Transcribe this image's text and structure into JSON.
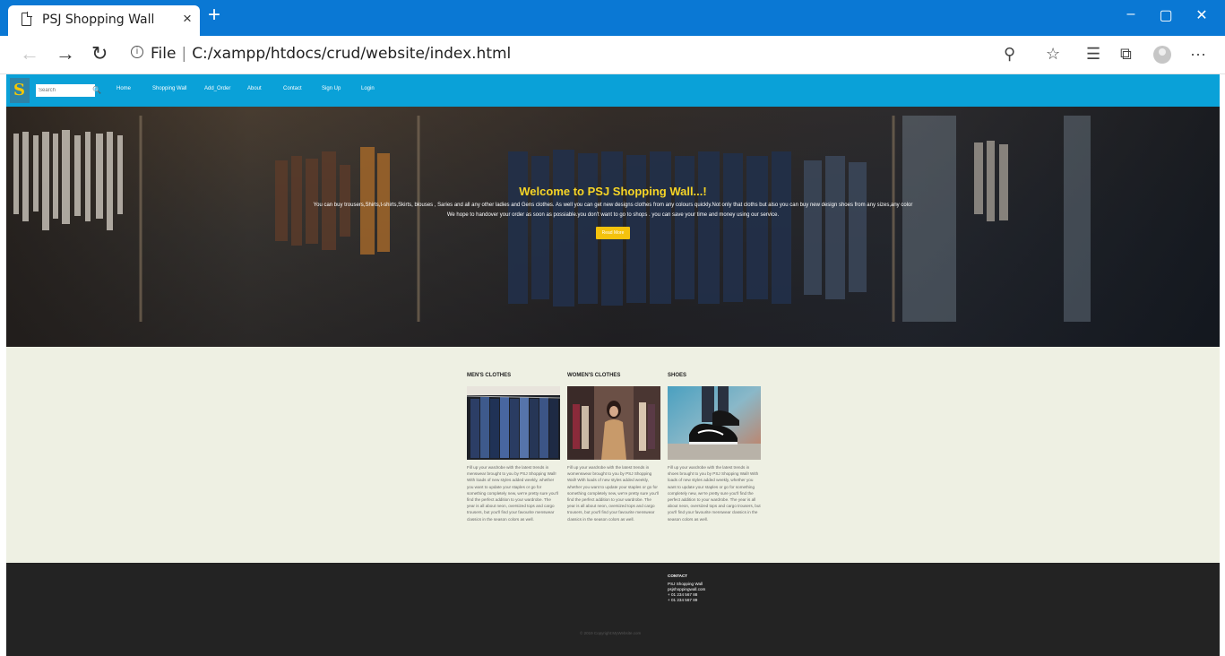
{
  "browser": {
    "tab_title": "PSJ Shopping Wall",
    "tab_close": "×",
    "new_tab": "+",
    "url_scheme": "File",
    "url_path": "C:/xampp/htdocs/crud/website/index.html",
    "window_controls": {
      "minimize": "–",
      "maximize": "▢",
      "close": "✕"
    },
    "icons": [
      "back-icon",
      "forward-icon",
      "refresh-icon",
      "info-icon",
      "zoom-icon",
      "favorite-star-icon",
      "favorites-list-icon",
      "collections-icon",
      "profile-icon",
      "more-icon"
    ],
    "colors": {
      "tabstrip": "#0a78d4"
    }
  },
  "site": {
    "nav": {
      "logo_letter": "S",
      "search_placeholder": "Search",
      "search_icon": "🔍",
      "items": [
        "Home",
        "Shopping Wall",
        "Add_Order",
        "About",
        "Contact",
        "Sign Up",
        "Login"
      ],
      "color": "#0aa1d8"
    },
    "hero": {
      "title": "Welcome to PSJ Shopping Wall...!",
      "line1": "You can buy trousers,Shirts,t-shirts,Skirts, blouses , Saries and all any other ladies and Gens clothes. As well you can get new designs clothes from any colours quickly.Not only that cloths but also you can buy new design shoes from any sizes,any color",
      "line2": "We hope to handover your order as soon as possiable.you don't want to go to shops . you can save your time and money using our service.",
      "button": "Read More"
    },
    "categories": [
      {
        "title": "MEN'S CLOTHES",
        "text": "Fill up your wardrobe with the latest trends in menswear brought to you by PSJ Shopping Wall! With loads of new styles added weekly, whether you want to update your staples or go for something completely new, we're pretty sure you'll find the perfect addition to your wardrobe. The year is all about neon, oversized tops and cargo trousers, but you'll find your favourite menswear classics in the season colors as well."
      },
      {
        "title": "WOMEN'S CLOTHES",
        "text": "Fill up your wardrobe with the latest trends in womenswear brought to you by PSJ Shopping Wall! With loads of new styles added weekly, whether you want to update your staples or go for something completely new, we're pretty sure you'll find the perfect addition to your wardrobe. The year is all about neon, oversized tops and cargo trousers, but you'll find your favourite menswear classics in the season colors as well."
      },
      {
        "title": "SHOES",
        "text": "Fill up your wardrobe with the latest trends in shoes brought to you by PSJ Shopping Wall! With loads of new styles added weekly, whether you want to update your staples or go for something completely new, we're pretty sure you'll find the perfect addition to your wardrobe. The year is all about neon, oversized tops and cargo trousers, but you'll find your favourite menswear classics in the season colors as well."
      }
    ],
    "footer": {
      "contact_heading": "CONTACT",
      "contact_lines": [
        "PSJ Shopping Wall",
        "psjshoppingwall.com",
        "+ 01 234 567 88",
        "+ 01 234 567 89"
      ],
      "copyright": "© 2019 Copyright:MyWebsite.com"
    }
  }
}
